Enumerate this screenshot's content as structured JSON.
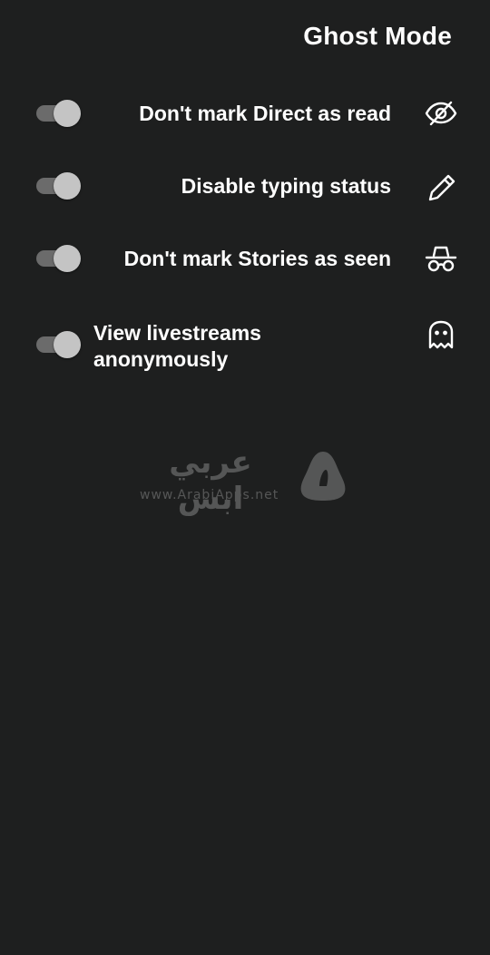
{
  "header": {
    "title": "Ghost Mode"
  },
  "settings": [
    {
      "label": "Don't mark Direct as read",
      "enabled": true,
      "icon": "eye-off-icon"
    },
    {
      "label": "Disable typing status",
      "enabled": true,
      "icon": "pencil-icon"
    },
    {
      "label": "Don't mark Stories as seen",
      "enabled": true,
      "icon": "incognito-icon"
    },
    {
      "label": "View livestreams anonymously",
      "enabled": true,
      "icon": "ghost-icon"
    }
  ],
  "watermark": {
    "arabic": "عربي ابس",
    "url": "www.ArabiApps.net"
  },
  "colors": {
    "background": "#1e1f1f",
    "toggle_track": "#6b6b6b",
    "toggle_thumb": "#c4c4c4",
    "text": "#ffffff"
  }
}
